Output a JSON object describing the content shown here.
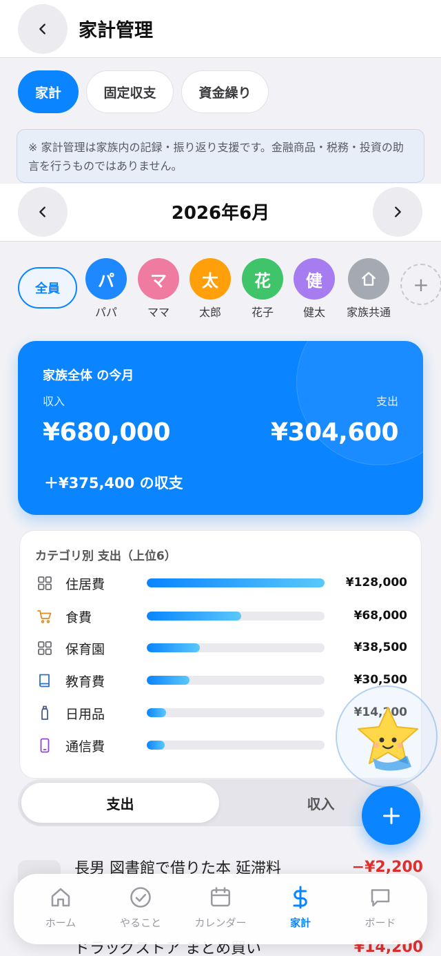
{
  "header": {
    "title": "家計管理",
    "back_icon": "chevron-left-icon"
  },
  "tabs": [
    {
      "label": "家計",
      "active": true
    },
    {
      "label": "固定収支",
      "active": false
    },
    {
      "label": "資金繰り",
      "active": false
    }
  ],
  "notice": "※ 家計管理は家族内の記録・振り返り支援です。金融商品・税務・投資の助言を行うものではありません。",
  "month": {
    "label": "2026年6月",
    "prev_icon": "chevron-left-icon",
    "next_icon": "chevron-right-icon"
  },
  "members": {
    "all_label": "全員",
    "items": [
      {
        "initial": "パ",
        "name": "パパ",
        "color": "#1e88ff"
      },
      {
        "initial": "マ",
        "name": "ママ",
        "color": "#ef7ba0"
      },
      {
        "initial": "太",
        "name": "太郎",
        "color": "#ff9f0a"
      },
      {
        "initial": "花",
        "name": "花子",
        "color": "#3fc46a"
      },
      {
        "initial": "健",
        "name": "健太",
        "color": "#a77cf0"
      },
      {
        "initial": "⌂",
        "name": "家族共通",
        "color": "#a4a9b2"
      }
    ],
    "add_icon": "plus-icon"
  },
  "summary": {
    "title": "家族全体 の今月",
    "income_label": "収入",
    "expense_label": "支出",
    "income": "¥680,000",
    "expense": "¥304,600",
    "balance": "＋¥375,400 の収支",
    "accent": "#0a84ff"
  },
  "categories": {
    "title": "カテゴリ別 支出（上位6）",
    "items": [
      {
        "name": "住居費",
        "amount": "¥128,000",
        "ratio": 1.0,
        "icon": "grid-icon"
      },
      {
        "name": "食費",
        "amount": "¥68,000",
        "ratio": 0.53,
        "icon": "cart-icon"
      },
      {
        "name": "保育園",
        "amount": "¥38,500",
        "ratio": 0.3,
        "icon": "grid-icon"
      },
      {
        "name": "教育費",
        "amount": "¥30,500",
        "ratio": 0.24,
        "icon": "book-icon"
      },
      {
        "name": "日用品",
        "amount": "¥14,200",
        "ratio": 0.11,
        "icon": "bottle-icon"
      },
      {
        "name": "通信費",
        "amount": "",
        "ratio": 0.1,
        "icon": "phone-icon"
      }
    ]
  },
  "segment": {
    "expense": "支出",
    "income": "収入"
  },
  "transactions": [
    {
      "title": "長男 図書館で借りた本 延滞料",
      "amount": "−¥2,200"
    },
    {
      "title": "ドラッグストア まとめ買い",
      "amount": "¥14,200"
    }
  ],
  "fab_icon": "plus-icon",
  "mascot_icon": "star-mascot-icon",
  "tabbar": [
    {
      "label": "ホーム",
      "icon": "home-icon",
      "active": false
    },
    {
      "label": "やること",
      "icon": "check-circle-icon",
      "active": false
    },
    {
      "label": "カレンダー",
      "icon": "calendar-icon",
      "active": false
    },
    {
      "label": "家計",
      "icon": "dollar-icon",
      "active": true
    },
    {
      "label": "ボード",
      "icon": "chat-bubble-icon",
      "active": false
    }
  ]
}
